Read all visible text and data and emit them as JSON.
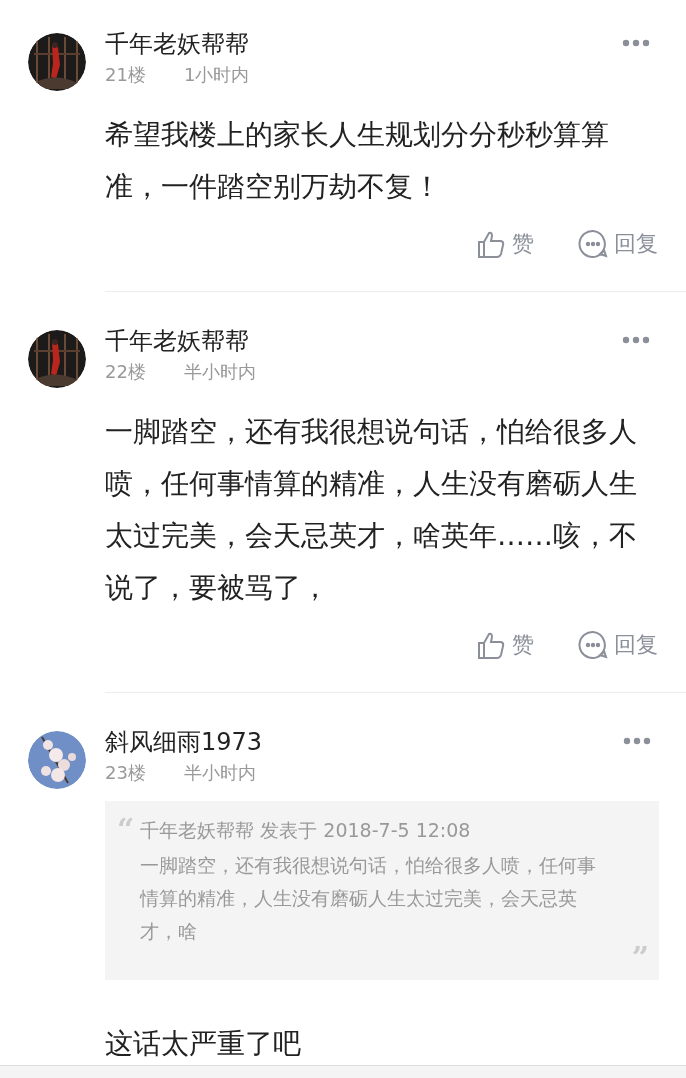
{
  "posts": [
    {
      "author": "千年老妖帮帮",
      "floor": "21楼",
      "time": "1小时内",
      "avatar": {
        "kind": "picture"
      },
      "body": "希望我楼上的家长人生规划分分秒秒算算准，一件踏空别万劫不复！",
      "actions": [
        {
          "kind": "like",
          "label": "赞"
        },
        {
          "kind": "reply",
          "label": "回复"
        }
      ]
    },
    {
      "author": "千年老妖帮帮",
      "floor": "22楼",
      "time": "半小时内",
      "avatar": {
        "kind": "picture"
      },
      "body": "一脚踏空，还有我很想说句话，怕给很多人喷，任何事情算的精准，人生没有磨砺人生太过完美，会天忌英才，啥英年……咳，不说了，要被骂了，",
      "actions": [
        {
          "kind": "like",
          "label": "赞"
        },
        {
          "kind": "reply",
          "label": "回复"
        }
      ]
    },
    {
      "author": "斜风细雨1973",
      "floor": "23楼",
      "time": "半小时内",
      "avatar": {
        "kind": "picture"
      },
      "quote": {
        "open": "“",
        "header": "千年老妖帮帮 发表于 2018-7-5 12:08",
        "text": "一脚踏空，还有我很想说句话，怕给很多人喷，任何事情算的精准，人生没有磨砺人生太过完美，会天忌英才，啥",
        "close": "”"
      },
      "body": "这话太严重了吧"
    }
  ]
}
